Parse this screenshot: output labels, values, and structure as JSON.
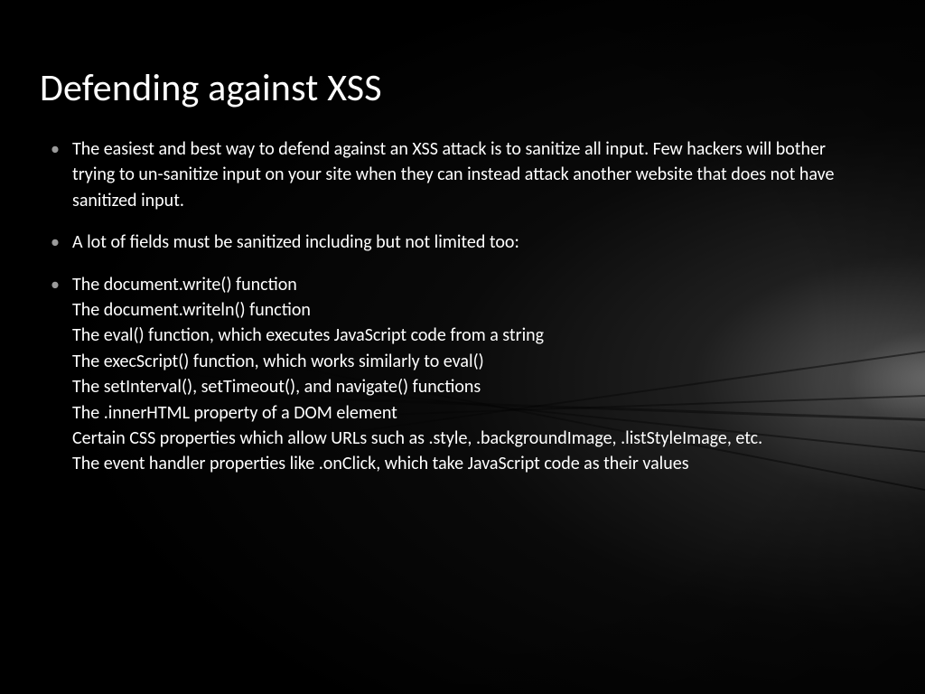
{
  "slide": {
    "title": "Defending against XSS",
    "bullets": [
      {
        "text": "The easiest and best way to defend against an XSS attack is to sanitize all input. Few hackers will bother trying to un-sanitize input on your site when they can instead attack another website that does not have sanitized input."
      },
      {
        "text": " A lot of fields must be sanitized including but not limited too:"
      },
      {
        "lines": [
          "The document.write() function",
          "The document.writeln() function",
          "The eval() function, which executes JavaScript code from a string",
          "The execScript() function, which works similarly to eval()",
          "The setInterval(), setTimeout(), and navigate() functions",
          "The .innerHTML property of a DOM element",
          "Certain CSS properties which allow URLs such as .style, .backgroundImage, .listStyleImage, etc.",
          "The event handler properties like .onClick, which take JavaScript code as their values"
        ]
      }
    ]
  }
}
